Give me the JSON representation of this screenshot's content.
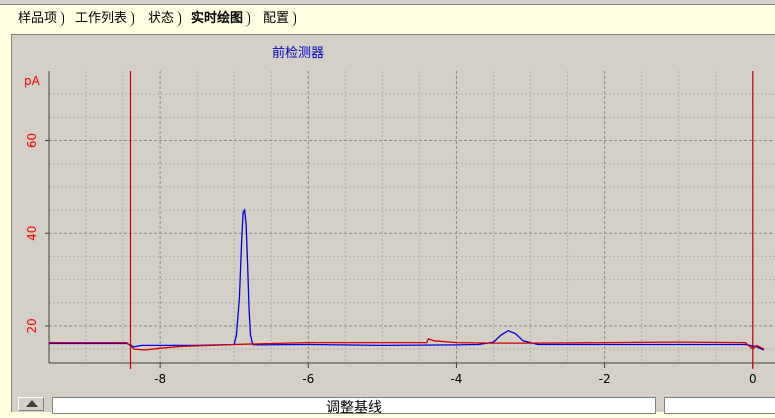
{
  "tabs": [
    {
      "label": "样品项",
      "active": false
    },
    {
      "label": "工作列表",
      "active": false
    },
    {
      "label": "状态",
      "active": false
    },
    {
      "label": "实时绘图",
      "active": true
    },
    {
      "label": "配置",
      "active": false
    }
  ],
  "panel": {
    "baseline_button_label": "调整基线"
  },
  "chart_data": {
    "type": "line",
    "title": "前检测器",
    "ylabel": "pA",
    "xlim": [
      -9.5,
      0.3
    ],
    "ylim": [
      12,
      75
    ],
    "xticks": [
      -8,
      -6,
      -4,
      -2,
      0
    ],
    "yticks": [
      20,
      40,
      60
    ],
    "grid": true,
    "markers_x": [
      -8.4,
      0
    ],
    "colors": {
      "trace_blue": "#0000e0",
      "trace_red": "#d00000",
      "marker": "#d00000",
      "axis_label": "#ff0000"
    },
    "series": [
      {
        "color": "#0000e0",
        "x": [
          -9.5,
          -8.45,
          -8.35,
          -8.25,
          -7.5,
          -7.0,
          -6.97,
          -6.93,
          -6.9,
          -6.88,
          -6.86,
          -6.84,
          -6.82,
          -6.8,
          -6.78,
          -6.75,
          -6.7,
          -6.0,
          -5.0,
          -4.0,
          -3.7,
          -3.5,
          -3.4,
          -3.3,
          -3.2,
          -3.1,
          -2.9,
          -2.0,
          -1.0,
          -0.1,
          0.05,
          0.15
        ],
        "y": [
          16.2,
          16.2,
          15.5,
          15.8,
          15.8,
          16.0,
          18.0,
          26.0,
          38.0,
          44.5,
          45.0,
          42.0,
          34.0,
          24.0,
          18.0,
          16.0,
          15.9,
          16.0,
          15.8,
          15.9,
          16.0,
          16.5,
          18.0,
          19.0,
          18.3,
          16.8,
          16.0,
          16.0,
          16.0,
          16.0,
          15.5,
          14.8
        ]
      },
      {
        "color": "#d00000",
        "x": [
          -9.5,
          -8.45,
          -8.35,
          -8.2,
          -8.0,
          -7.7,
          -7.3,
          -7.0,
          -6.5,
          -6.0,
          -5.0,
          -4.4,
          -4.38,
          -4.3,
          -4.0,
          -3.5,
          -3.0,
          -2.0,
          -1.0,
          -0.1,
          0.0,
          0.05,
          0.15
        ],
        "y": [
          16.4,
          16.4,
          15.0,
          14.8,
          15.2,
          15.6,
          15.8,
          16.0,
          16.2,
          16.4,
          16.4,
          16.4,
          17.2,
          16.8,
          16.4,
          16.3,
          16.3,
          16.4,
          16.5,
          16.4,
          15.0,
          15.8,
          15.0
        ]
      }
    ]
  }
}
